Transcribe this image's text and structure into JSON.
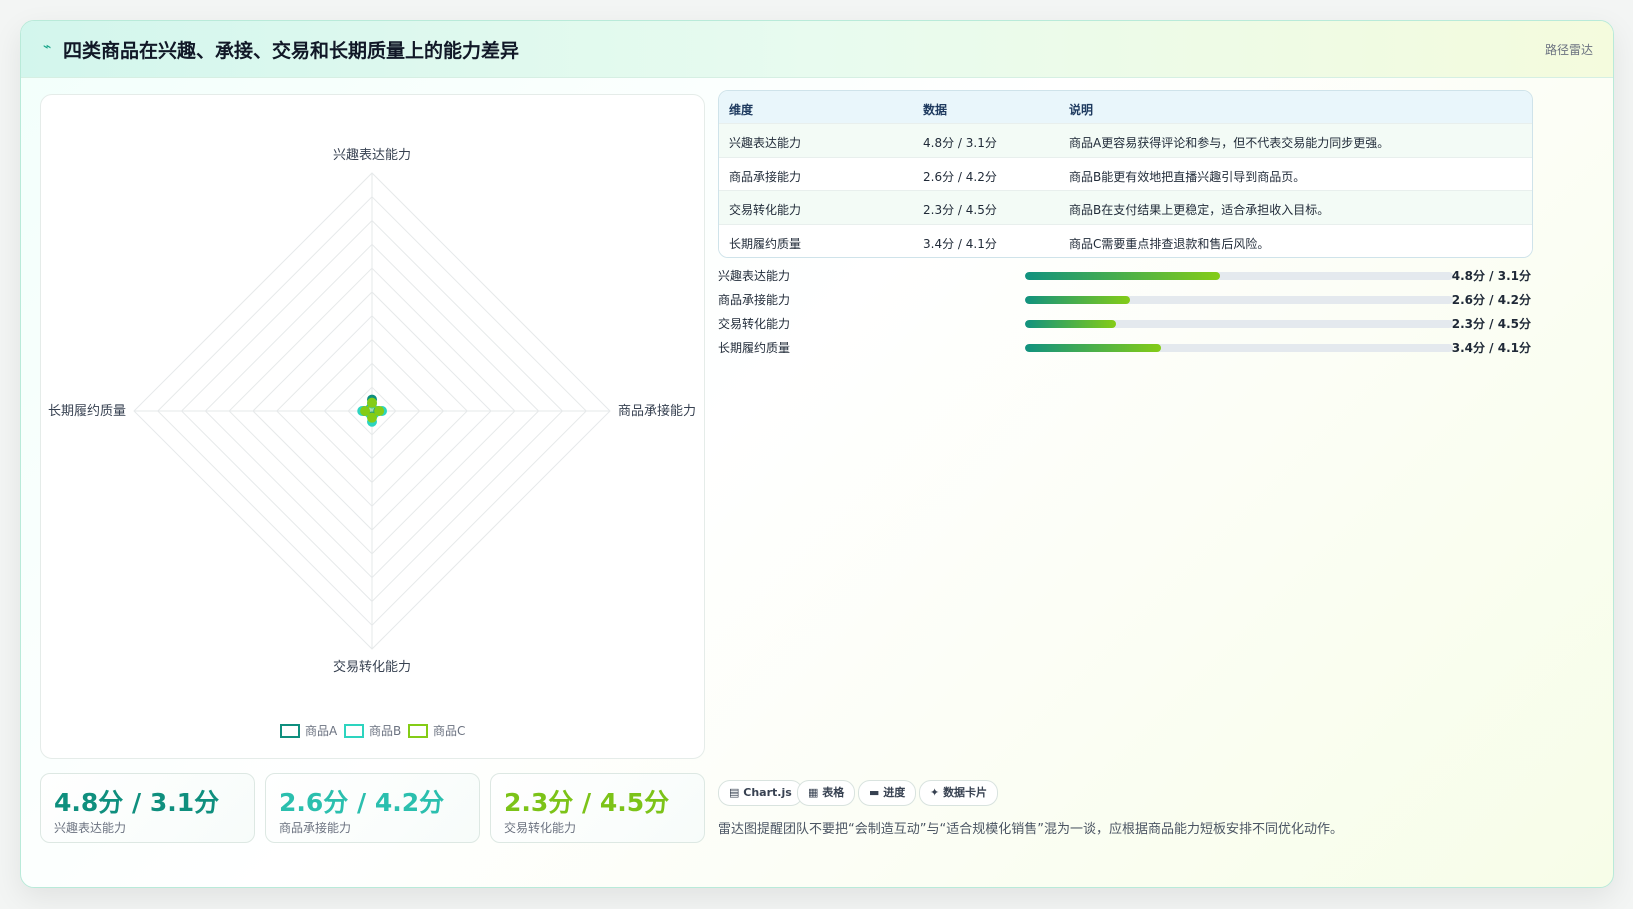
{
  "header": {
    "icon": "⌁",
    "title": "四类商品在兴趣、承接、交易和长期质量上的能力差异",
    "tag": "路径雷达"
  },
  "chart_data": {
    "type": "radar",
    "axes": [
      "兴趣表达能力",
      "商品承接能力",
      "交易转化能力",
      "长期履约质量"
    ],
    "rmax": 100,
    "rings": 10,
    "series": [
      {
        "name": "商品A",
        "values": [
          4.8,
          2.6,
          2.3,
          3.4
        ]
      },
      {
        "name": "商品B",
        "values": [
          3.1,
          4.2,
          4.5,
          4.1
        ]
      },
      {
        "name": "商品C",
        "values": [
          3.5,
          3.0,
          2.8,
          2.9
        ]
      }
    ],
    "legend": [
      "商品A",
      "商品B",
      "商品C"
    ],
    "legend_position": "bottom",
    "colors": [
      "#0f8f7e",
      "#2dd4bf",
      "#84cc16"
    ]
  },
  "kpis": [
    {
      "value": "4.8分 / 3.1分",
      "label": "兴趣表达能力",
      "color": "#0f8f7e"
    },
    {
      "value": "2.6分 / 4.2分",
      "label": "商品承接能力",
      "color": "#2bbfae"
    },
    {
      "value": "2.3分 / 4.5分",
      "label": "交易转化能力",
      "color": "#7cc318"
    }
  ],
  "table": {
    "headers": [
      "维度",
      "数据",
      "说明"
    ],
    "rows": [
      [
        "兴趣表达能力",
        "4.8分 / 3.1分",
        "商品A更容易获得评论和参与，但不代表交易能力同步更强。"
      ],
      [
        "商品承接能力",
        "2.6分 / 4.2分",
        "商品B能更有效地把直播兴趣引导到商品页。"
      ],
      [
        "交易转化能力",
        "2.3分 / 4.5分",
        "商品B在支付结果上更稳定，适合承担收入目标。"
      ],
      [
        "长期履约质量",
        "3.4分 / 4.1分",
        "商品C需要重点排查退款和售后风险。"
      ]
    ]
  },
  "bars": [
    {
      "label": "兴趣表达能力",
      "value": "4.8分 / 3.1分",
      "fraction": 0.455
    },
    {
      "label": "商品承接能力",
      "value": "2.6分 / 4.2分",
      "fraction": 0.246
    },
    {
      "label": "交易转化能力",
      "value": "2.3分 / 4.5分",
      "fraction": 0.213
    },
    {
      "label": "长期履约质量",
      "value": "3.4分 / 4.1分",
      "fraction": 0.318
    }
  ],
  "chips": [
    {
      "icon": "▤",
      "label": "Chart.js"
    },
    {
      "icon": "▦",
      "label": "表格"
    },
    {
      "icon": "▬",
      "label": "进度"
    },
    {
      "icon": "✦",
      "label": "数据卡片"
    }
  ],
  "note": "雷达图提醒团队不要把“会制造互动”与“适合规模化销售”混为一谈，应根据商品能力短板安排不同优化动作。"
}
